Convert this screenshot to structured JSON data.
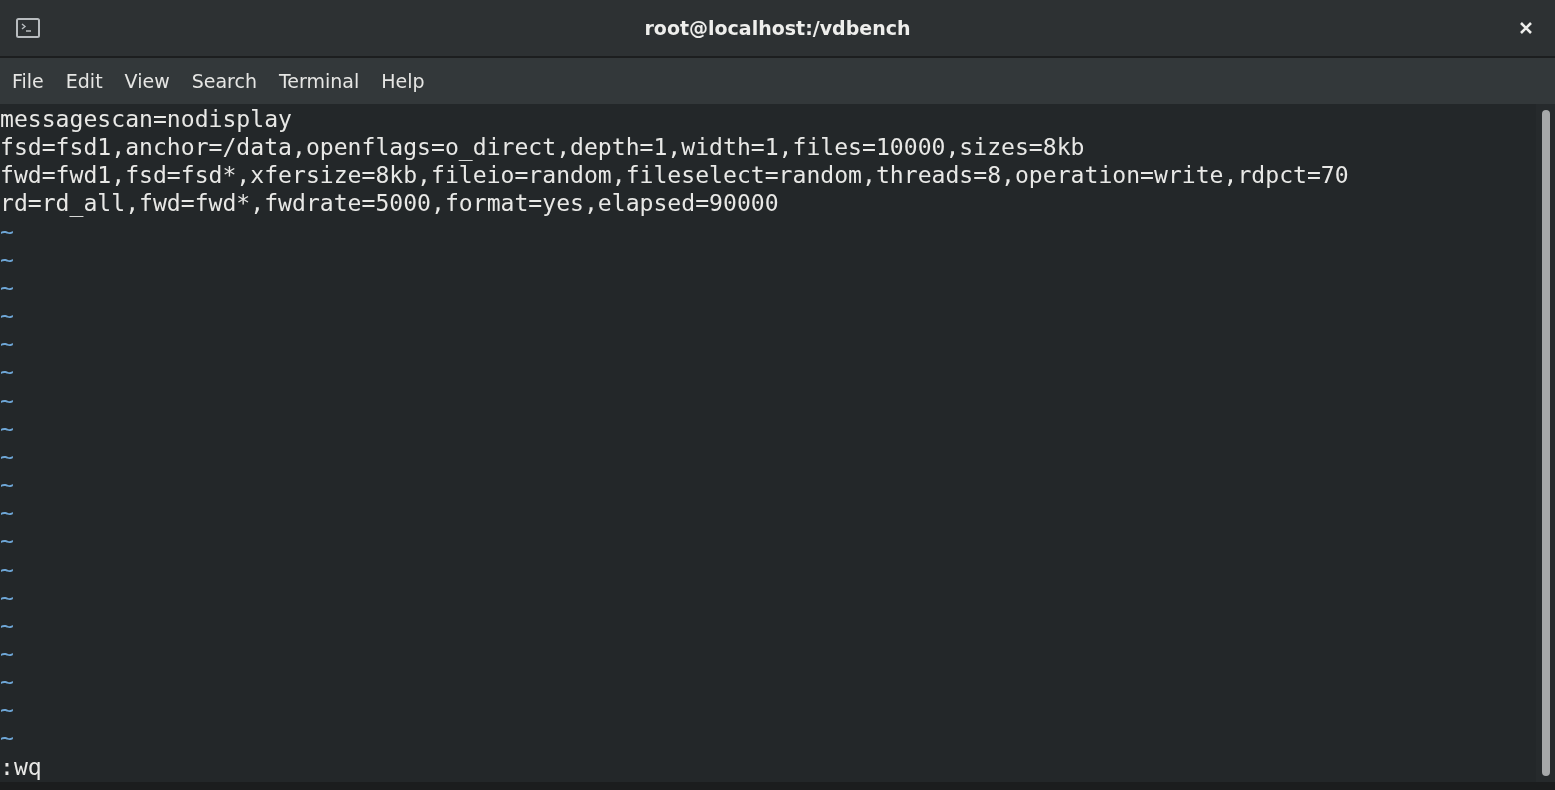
{
  "window": {
    "title": "root@localhost:/vdbench"
  },
  "menu": [
    "File",
    "Edit",
    "View",
    "Search",
    "Terminal",
    "Help"
  ],
  "terminal": {
    "lines": [
      "messagescan=nodisplay",
      "fsd=fsd1,anchor=/data,openflags=o_direct,depth=1,width=1,files=10000,sizes=8kb",
      "fwd=fwd1,fsd=fsd*,xfersize=8kb,fileio=random,fileselect=random,threads=8,operation=write,rdpct=70",
      "rd=rd_all,fwd=fwd*,fwdrate=5000,format=yes,elapsed=90000"
    ],
    "empty_line_markers": [
      "~",
      "~",
      "~",
      "~",
      "~",
      "~",
      "~",
      "~",
      "~",
      "~",
      "~",
      "~",
      "~",
      "~",
      "~",
      "~",
      "~",
      "~",
      "~"
    ],
    "command_line": ":wq"
  }
}
